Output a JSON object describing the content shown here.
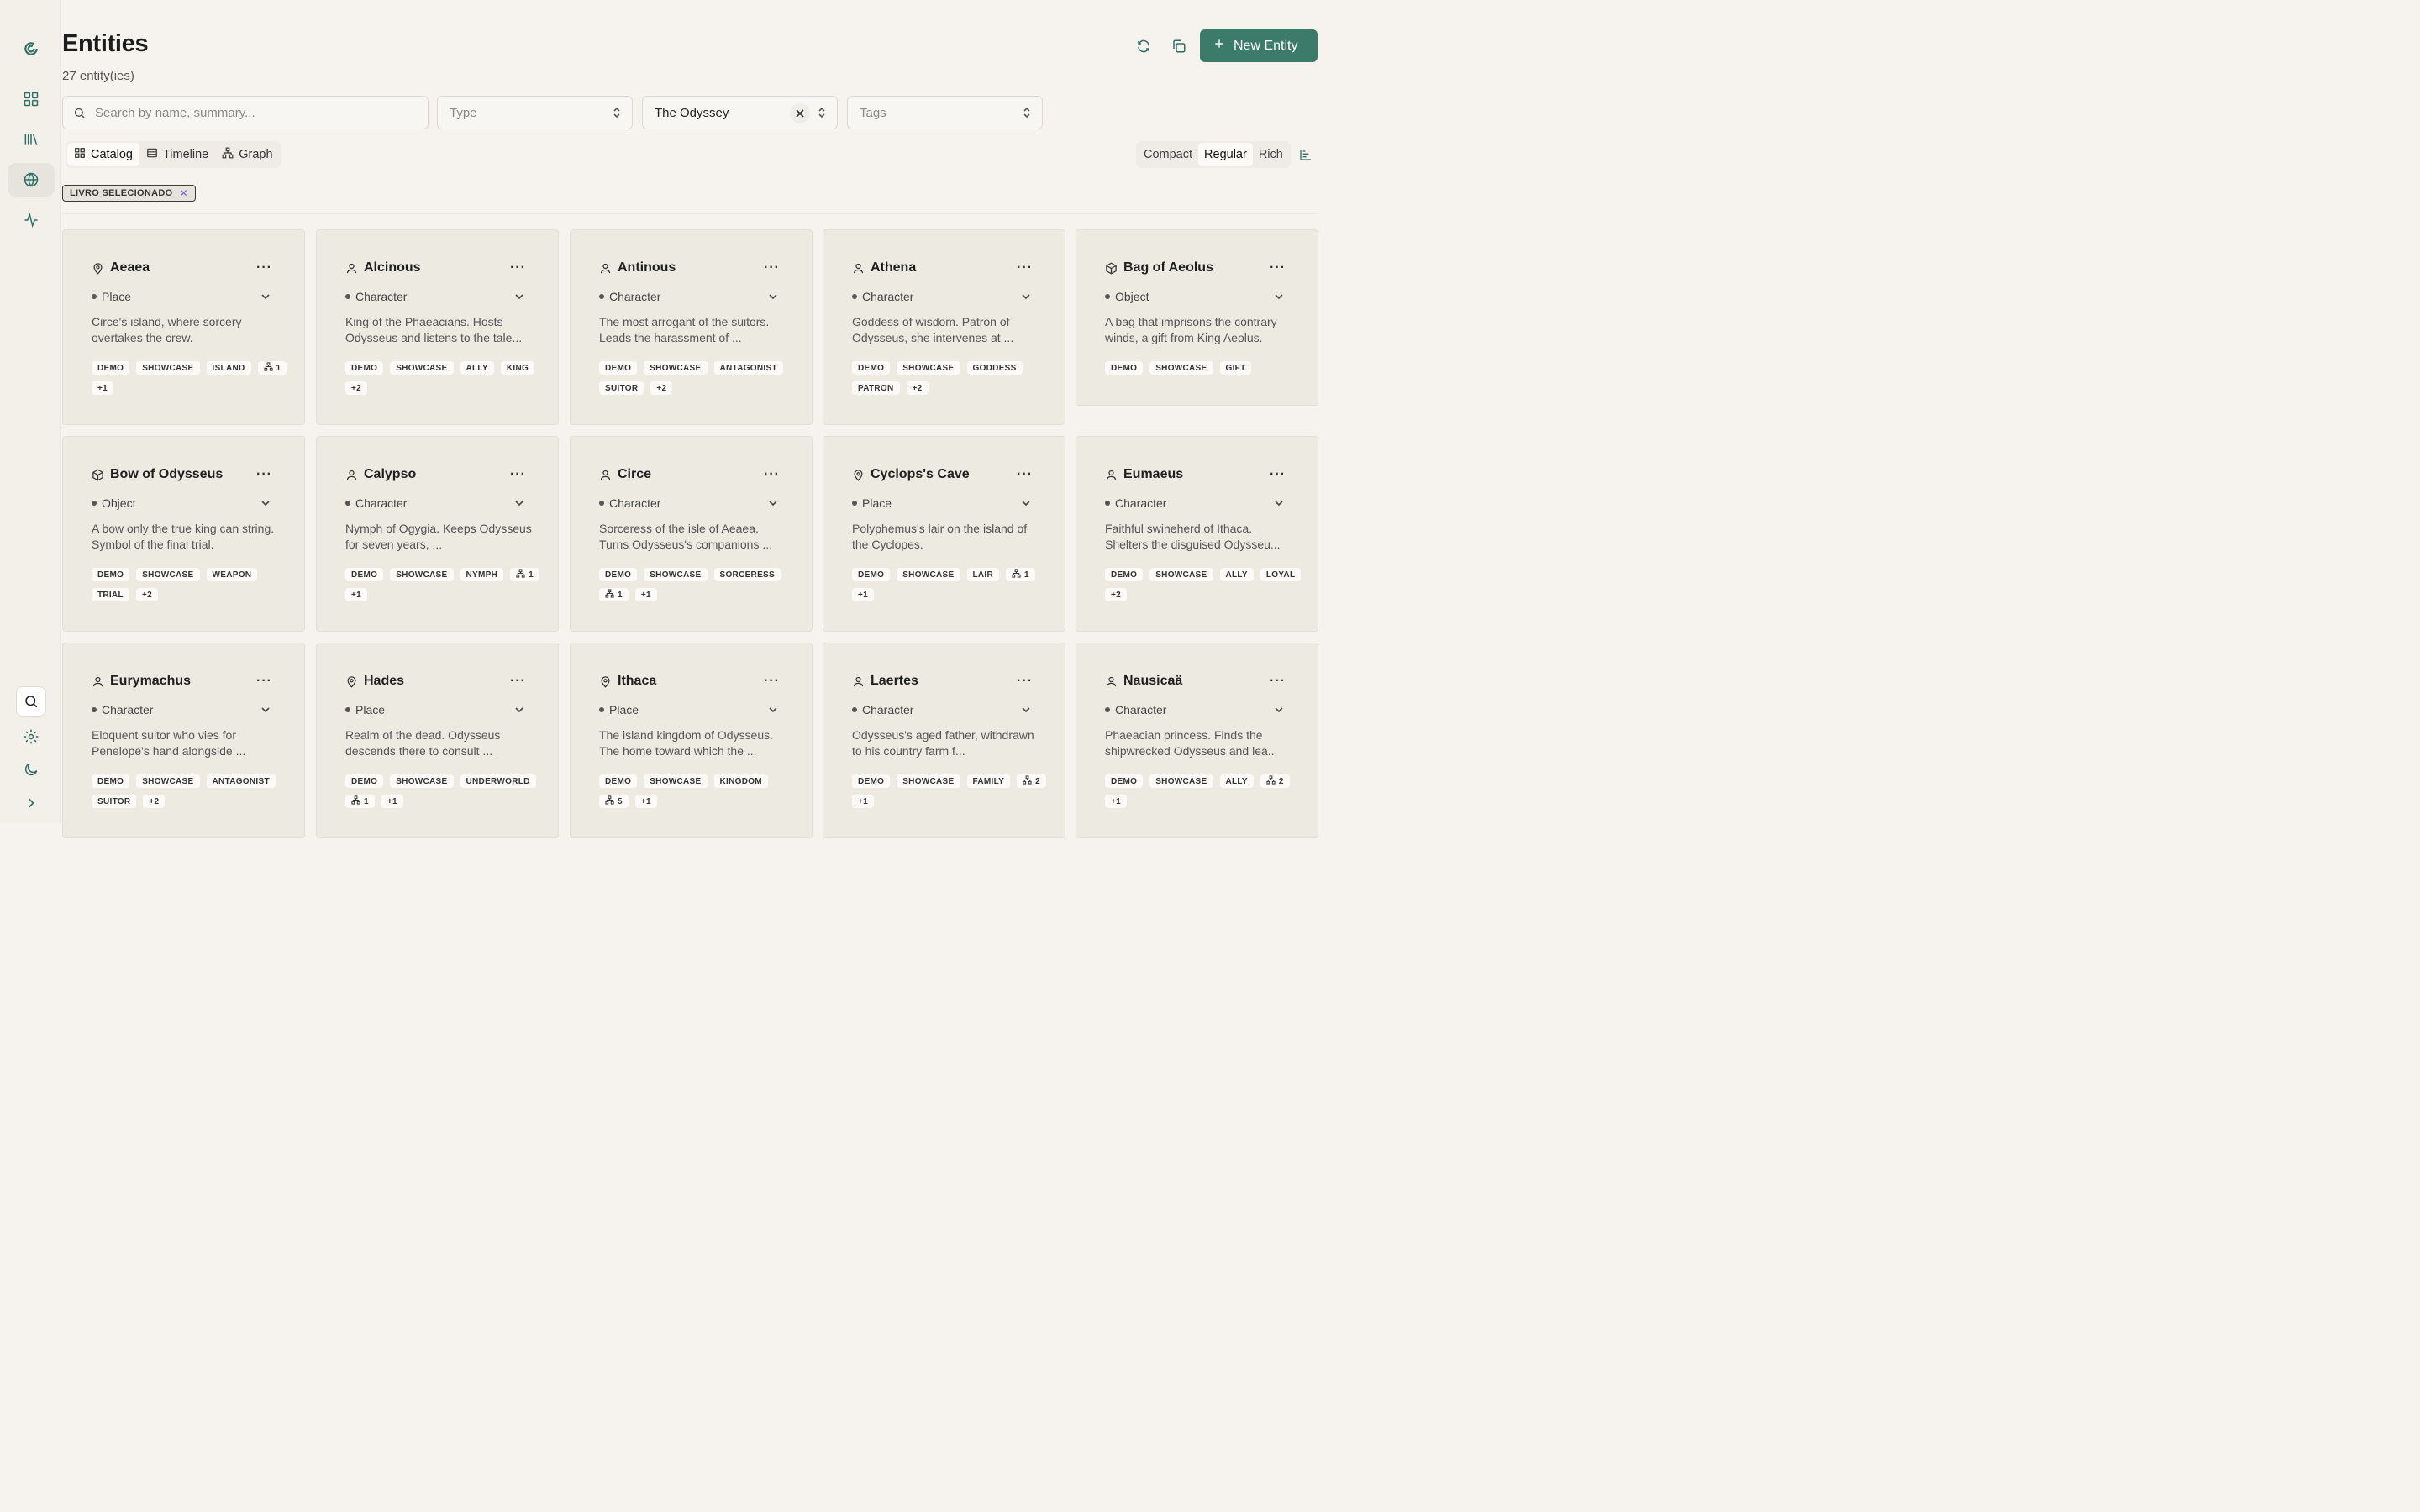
{
  "sidebar": {
    "icons": [
      "logo-icon",
      "dashboard-icon",
      "library-icon",
      "globe-icon",
      "activity-icon"
    ],
    "bottom_icons": [
      "search-icon",
      "settings-icon",
      "moon-icon",
      "chevron-right-icon"
    ]
  },
  "header": {
    "title": "Entities",
    "count": "27 entity(ies)",
    "new_button": "New Entity"
  },
  "filters": {
    "search_placeholder": "Search by name, summary...",
    "type_placeholder": "Type",
    "book_value": "The Odyssey",
    "tags_placeholder": "Tags"
  },
  "views": {
    "tabs": [
      "Catalog",
      "Timeline",
      "Graph"
    ],
    "active": "Catalog",
    "density": [
      "Compact",
      "Regular",
      "Rich"
    ],
    "density_active": "Regular"
  },
  "active_filter_chip": "LIVRO SELECIONADO",
  "cards": [
    {
      "name": "Aeaea",
      "icon": "pin-icon",
      "type": "Place",
      "summary": "Circe's island, where sorcery overtakes the crew.",
      "tags": [
        "DEMO",
        "SHOWCASE",
        "ISLAND"
      ],
      "rel": "1",
      "more": "+1"
    },
    {
      "name": "Alcinous",
      "icon": "person-icon",
      "type": "Character",
      "summary": "King of the Phaeacians. Hosts Odysseus and listens to the tale...",
      "tags": [
        "DEMO",
        "SHOWCASE",
        "ALLY",
        "KING"
      ],
      "rel": "",
      "more": "+2"
    },
    {
      "name": "Antinous",
      "icon": "person-icon",
      "type": "Character",
      "summary": "The most arrogant of the suitors. Leads the harassment of ...",
      "tags": [
        "DEMO",
        "SHOWCASE",
        "ANTAGONIST",
        "SUITOR"
      ],
      "rel": "",
      "more": "+2"
    },
    {
      "name": "Athena",
      "icon": "person-icon",
      "type": "Character",
      "summary": "Goddess of wisdom. Patron of Odysseus, she intervenes at ...",
      "tags": [
        "DEMO",
        "SHOWCASE",
        "GODDESS",
        "PATRON"
      ],
      "rel": "",
      "more": "+2"
    },
    {
      "name": "Bag of Aeolus",
      "icon": "box-icon",
      "type": "Object",
      "summary": "A bag that imprisons the contrary winds, a gift from King Aeolus.",
      "tags": [
        "DEMO",
        "SHOWCASE",
        "GIFT"
      ],
      "rel": "",
      "more": ""
    },
    {
      "name": "Bow of Odysseus",
      "icon": "box-icon",
      "type": "Object",
      "summary": "A bow only the true king can string. Symbol of the final trial.",
      "tags": [
        "DEMO",
        "SHOWCASE",
        "WEAPON",
        "TRIAL"
      ],
      "rel": "",
      "more": "+2"
    },
    {
      "name": "Calypso",
      "icon": "person-icon",
      "type": "Character",
      "summary": "Nymph of Ogygia. Keeps Odysseus for seven years, ...",
      "tags": [
        "DEMO",
        "SHOWCASE",
        "NYMPH"
      ],
      "rel": "1",
      "more": "+1"
    },
    {
      "name": "Circe",
      "icon": "person-icon",
      "type": "Character",
      "summary": "Sorceress of the isle of Aeaea. Turns Odysseus's companions ...",
      "tags": [
        "DEMO",
        "SHOWCASE",
        "SORCERESS"
      ],
      "rel": "1",
      "more": "+1"
    },
    {
      "name": "Cyclops's Cave",
      "icon": "pin-icon",
      "type": "Place",
      "summary": "Polyphemus's lair on the island of the Cyclopes.",
      "tags": [
        "DEMO",
        "SHOWCASE",
        "LAIR"
      ],
      "rel": "1",
      "more": "+1"
    },
    {
      "name": "Eumaeus",
      "icon": "person-icon",
      "type": "Character",
      "summary": "Faithful swineherd of Ithaca. Shelters the disguised Odysseu...",
      "tags": [
        "DEMO",
        "SHOWCASE",
        "ALLY",
        "LOYAL"
      ],
      "rel": "",
      "more": "+2"
    },
    {
      "name": "Eurymachus",
      "icon": "person-icon",
      "type": "Character",
      "summary": "Eloquent suitor who vies for Penelope's hand alongside ...",
      "tags": [
        "DEMO",
        "SHOWCASE",
        "ANTAGONIST",
        "SUITOR"
      ],
      "rel": "",
      "more": "+2"
    },
    {
      "name": "Hades",
      "icon": "pin-icon",
      "type": "Place",
      "summary": "Realm of the dead. Odysseus descends there to consult ...",
      "tags": [
        "DEMO",
        "SHOWCASE",
        "UNDERWORLD"
      ],
      "rel": "1",
      "more": "+1"
    },
    {
      "name": "Ithaca",
      "icon": "pin-icon",
      "type": "Place",
      "summary": "The island kingdom of Odysseus. The home toward which the ...",
      "tags": [
        "DEMO",
        "SHOWCASE",
        "KINGDOM"
      ],
      "rel": "5",
      "more": "+1"
    },
    {
      "name": "Laertes",
      "icon": "person-icon",
      "type": "Character",
      "summary": "Odysseus's aged father, withdrawn to his country farm f...",
      "tags": [
        "DEMO",
        "SHOWCASE",
        "FAMILY"
      ],
      "rel": "2",
      "more": "+1"
    },
    {
      "name": "Nausicaä",
      "icon": "person-icon",
      "type": "Character",
      "summary": "Phaeacian princess. Finds the shipwrecked Odysseus and lea...",
      "tags": [
        "DEMO",
        "SHOWCASE",
        "ALLY"
      ],
      "rel": "2",
      "more": "+1"
    }
  ]
}
